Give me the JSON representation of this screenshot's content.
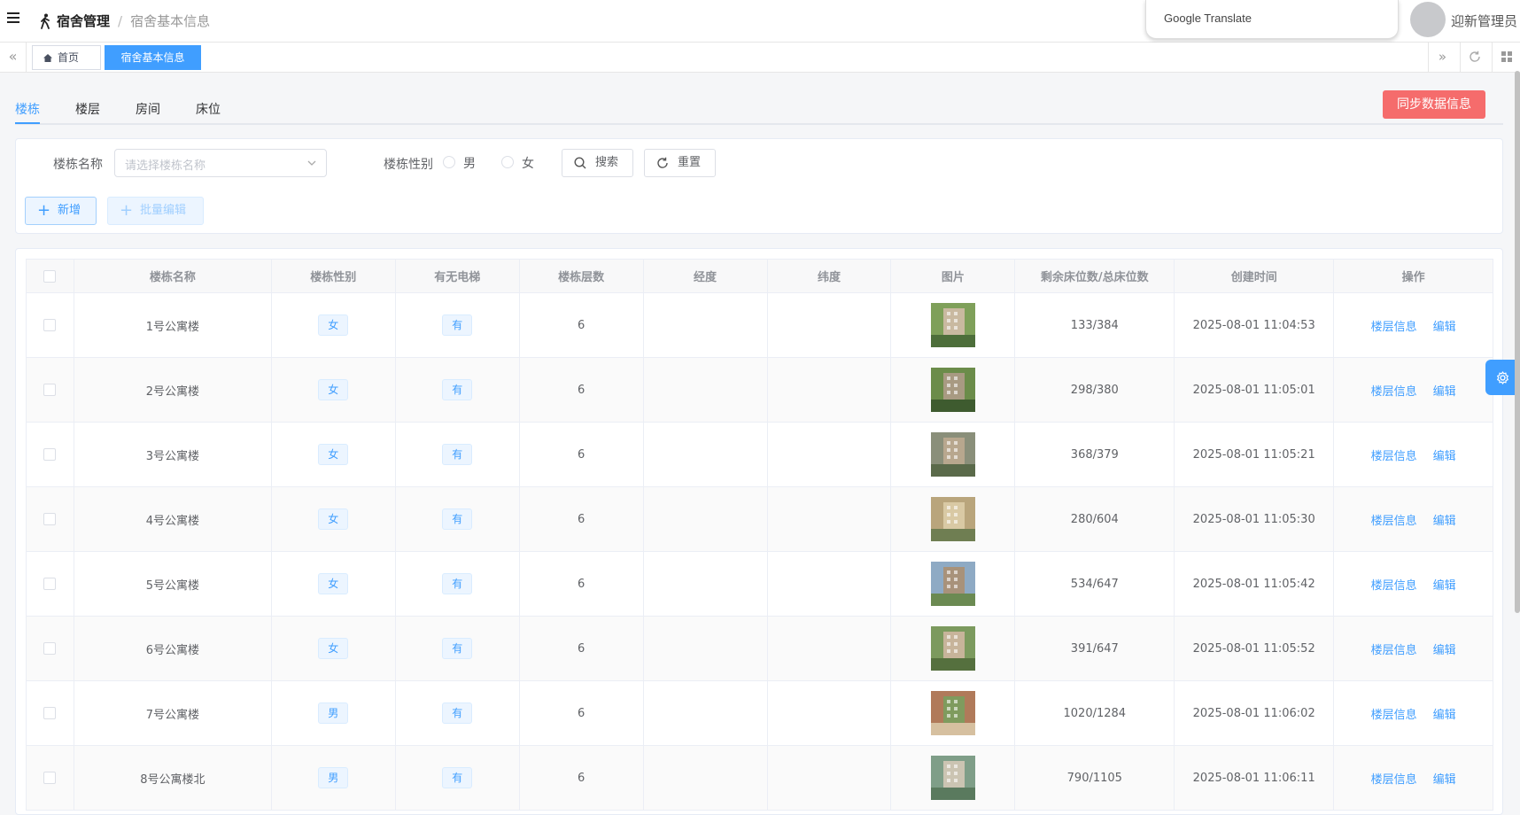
{
  "header": {
    "title": "宿舍管理",
    "subtitle": "宿舍基本信息",
    "translate_label": "Google Translate",
    "user_name": "迎新管理员"
  },
  "tagsbar": {
    "home": "首页",
    "active": "宿舍基本信息"
  },
  "tabs": [
    {
      "label": "楼栋",
      "active": true
    },
    {
      "label": "楼层",
      "active": false
    },
    {
      "label": "房间",
      "active": false
    },
    {
      "label": "床位",
      "active": false
    }
  ],
  "sync_button": "同步数据信息",
  "search": {
    "name_label": "楼栋名称",
    "name_placeholder": "请选择楼栋名称",
    "gender_label": "楼栋性别",
    "gender_options": [
      "男",
      "女"
    ],
    "search_button": "搜索",
    "reset_button": "重置",
    "add_button": "新增",
    "batch_edit_button": "批量编辑"
  },
  "table": {
    "columns": [
      "楼栋名称",
      "楼栋性别",
      "有无电梯",
      "楼栋层数",
      "经度",
      "纬度",
      "图片",
      "剩余床位数/总床位数",
      "创建时间",
      "操作"
    ],
    "op_labels": [
      "楼层信息",
      "编辑"
    ],
    "rows": [
      {
        "name": "1号公寓楼",
        "gender": "女",
        "elevator": "有",
        "floors": "6",
        "lng": "",
        "lat": "",
        "beds": "133/384",
        "created": "2025-08-01 11:04:53"
      },
      {
        "name": "2号公寓楼",
        "gender": "女",
        "elevator": "有",
        "floors": "6",
        "lng": "",
        "lat": "",
        "beds": "298/380",
        "created": "2025-08-01 11:05:01"
      },
      {
        "name": "3号公寓楼",
        "gender": "女",
        "elevator": "有",
        "floors": "6",
        "lng": "",
        "lat": "",
        "beds": "368/379",
        "created": "2025-08-01 11:05:21"
      },
      {
        "name": "4号公寓楼",
        "gender": "女",
        "elevator": "有",
        "floors": "6",
        "lng": "",
        "lat": "",
        "beds": "280/604",
        "created": "2025-08-01 11:05:30"
      },
      {
        "name": "5号公寓楼",
        "gender": "女",
        "elevator": "有",
        "floors": "6",
        "lng": "",
        "lat": "",
        "beds": "534/647",
        "created": "2025-08-01 11:05:42"
      },
      {
        "name": "6号公寓楼",
        "gender": "女",
        "elevator": "有",
        "floors": "6",
        "lng": "",
        "lat": "",
        "beds": "391/647",
        "created": "2025-08-01 11:05:52"
      },
      {
        "name": "7号公寓楼",
        "gender": "男",
        "elevator": "有",
        "floors": "6",
        "lng": "",
        "lat": "",
        "beds": "1020/1284",
        "created": "2025-08-01 11:06:02"
      },
      {
        "name": "8号公寓楼北",
        "gender": "男",
        "elevator": "有",
        "floors": "6",
        "lng": "",
        "lat": "",
        "beds": "790/1105",
        "created": "2025-08-01 11:06:11"
      }
    ]
  },
  "colors": {
    "primary": "#409eff",
    "danger": "#f56c6c"
  },
  "icons": {
    "menu": "menu-icon",
    "walk": "walking-person-icon",
    "home": "home-icon",
    "search": "search-icon",
    "reset": "refresh-icon",
    "settings": "gear-icon"
  }
}
